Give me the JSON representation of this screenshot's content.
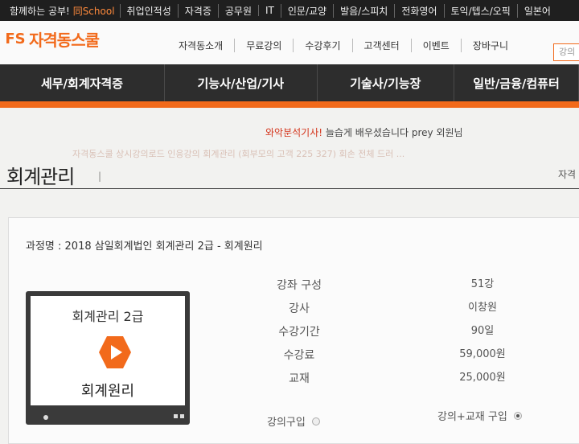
{
  "top_links": {
    "first_prefix": "함께하는 공부! ",
    "first_brand": "同School",
    "items": [
      "취업인적성",
      "자격증",
      "공무원",
      "IT",
      "인문/교양",
      "발음/스피치",
      "전화영어",
      "토익/텝스/오픽",
      "일본어"
    ]
  },
  "logo": {
    "mark": "FS",
    "text": "자격동스쿨"
  },
  "header_nav": [
    "자격동소개",
    "무료강의",
    "수강후기",
    "고객센터",
    "이벤트",
    "장바구니"
  ],
  "search": {
    "placeholder": "강의"
  },
  "categories": [
    "세무/회계자격증",
    "기능사/산업/기사",
    "기술사/기능장",
    "일반/금융/컴퓨터"
  ],
  "notice": {
    "highlight": "와악분석기사!",
    "text": " 늘습게 배우셨습니다 prey",
    "suffix": " 외원님"
  },
  "faded_line": "자격동스쿨  상시강의로드 인응강의 회계관리 (회부모의 고객 225 327) 회손 전체 드러 ...",
  "page": {
    "title": "회계관리",
    "sep": "|",
    "right": "자격"
  },
  "course": {
    "name": "과정명 : 2018 삼일회계법인 회계관리 2급 - 회계원리"
  },
  "thumbnail": {
    "line1": "회계관리 2급",
    "line2": "회계원리"
  },
  "info": [
    {
      "label": "강좌 구성",
      "value": "51강"
    },
    {
      "label": "강사",
      "value": "이창원"
    },
    {
      "label": "수강기간",
      "value": "90일"
    },
    {
      "label": "수강료",
      "value": "59,000원"
    },
    {
      "label": "교재",
      "value": "25,000원"
    }
  ],
  "purchase": {
    "option1": {
      "label": "강의구입",
      "selected": false
    },
    "option2": {
      "label": "강의+교재 구입",
      "selected": true
    }
  },
  "colors": {
    "accent": "#f26a1b",
    "dark_bar": "#2d2d2d"
  }
}
